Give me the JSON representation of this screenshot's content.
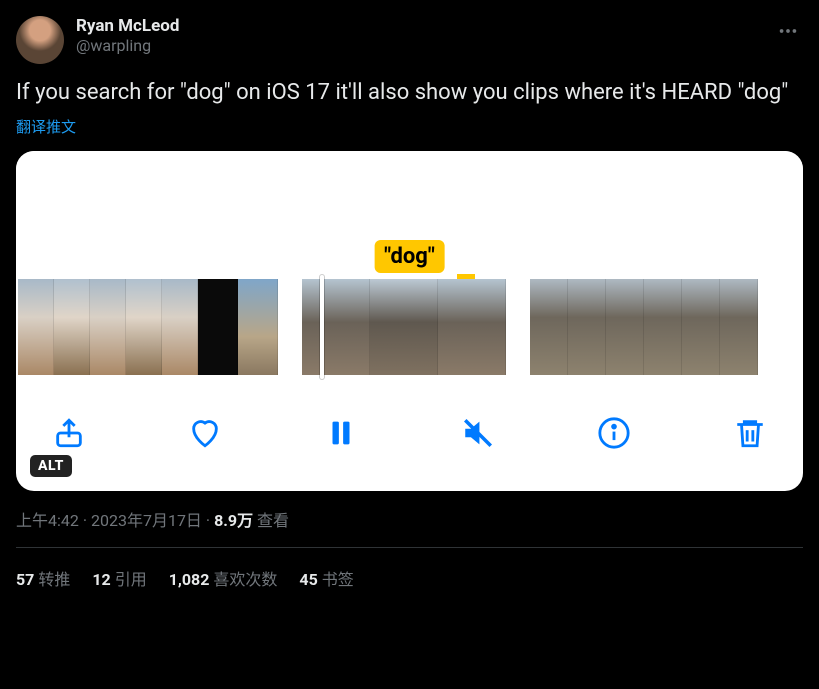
{
  "author": {
    "name": "Ryan McLeod",
    "handle": "@warpling"
  },
  "tweet_text": "If you search for \"dog\" on iOS 17 it'll also show you clips where it's HEARD \"dog\"",
  "translate_label": "翻译推文",
  "caption_text": "\"dog\"",
  "alt_badge": "ALT",
  "meta": {
    "time": "上午4:42",
    "date": "2023年7月17日",
    "views_number": "8.9万",
    "views_label": "查看"
  },
  "stats": {
    "retweets": {
      "count": "57",
      "label": "转推"
    },
    "quotes": {
      "count": "12",
      "label": "引用"
    },
    "likes": {
      "count": "1,082",
      "label": "喜欢次数"
    },
    "bookmarks": {
      "count": "45",
      "label": "书签"
    }
  },
  "icons": {
    "more": "more-icon",
    "share": "share-icon",
    "heart": "heart-icon",
    "pause": "pause-icon",
    "mute": "mute-icon",
    "info": "info-icon",
    "trash": "trash-icon"
  }
}
